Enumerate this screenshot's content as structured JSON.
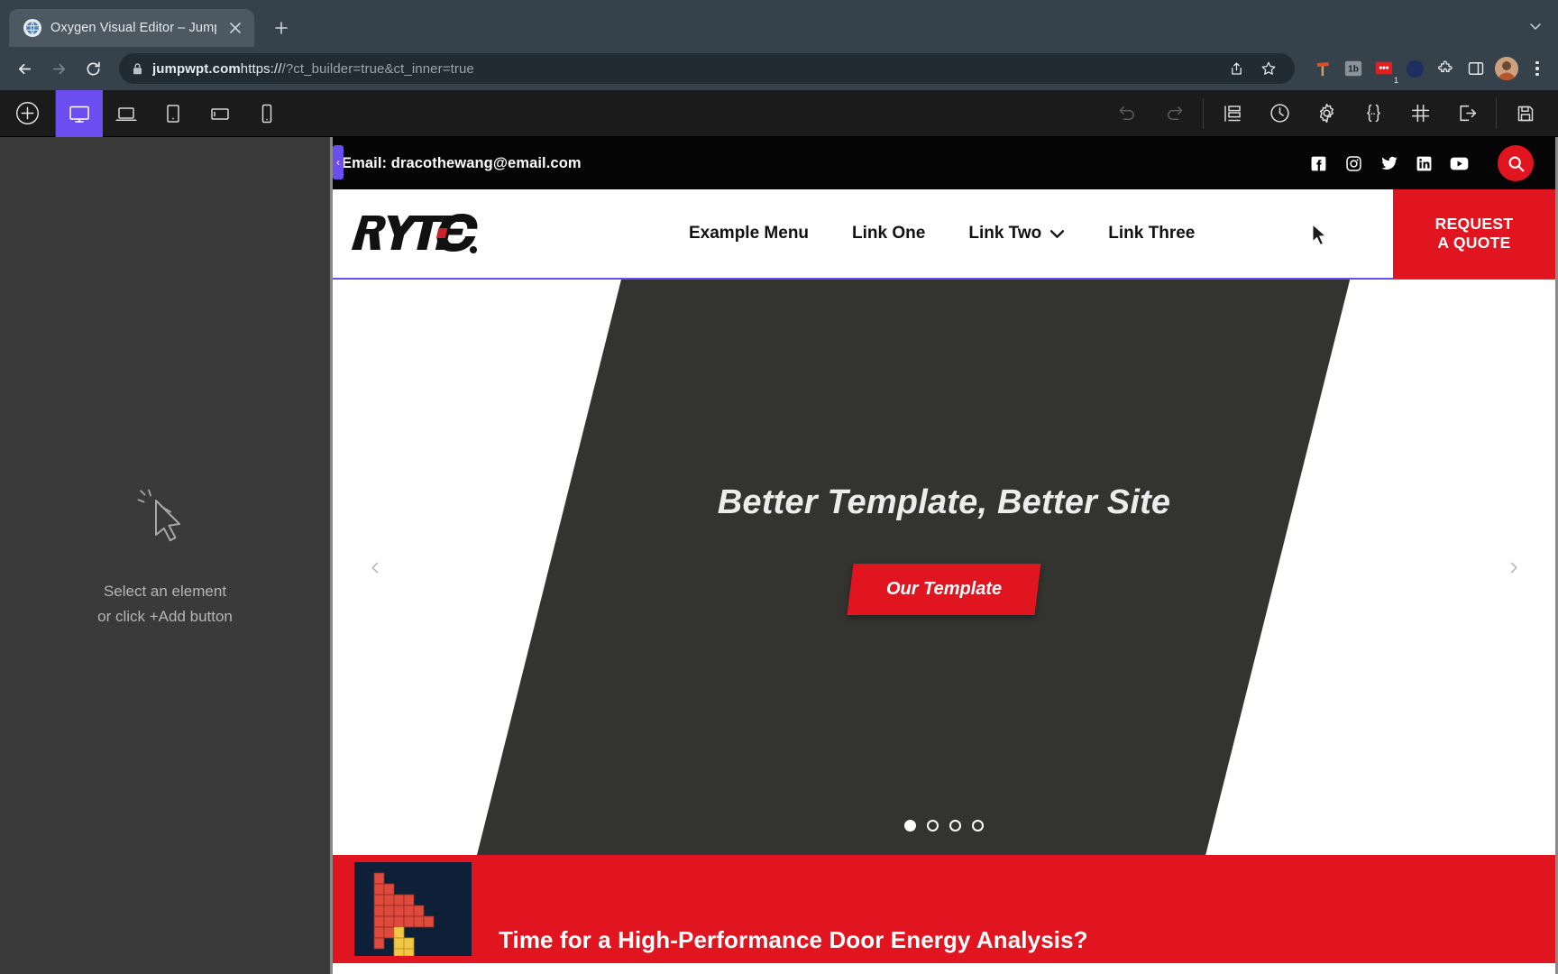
{
  "browser": {
    "tab": {
      "title": "Oxygen Visual Editor – JumpW",
      "favicon_icon": "globe-icon",
      "close_icon": "close-icon"
    },
    "new_tab_label": "+",
    "tabstrip_menu_icon": "chevron-down-icon",
    "nav": {
      "back_icon": "back-arrow-icon",
      "forward_icon": "forward-arrow-icon",
      "reload_icon": "reload-icon"
    },
    "url": {
      "lock_icon": "lock-icon",
      "scheme": "https://",
      "domain": "jumpwpt.com",
      "path": "/?ct_builder=true&ct_inner=true",
      "full": "https://jumpwpt.com/?ct_builder=true&ct_inner=true"
    },
    "omnibar_actions": [
      {
        "name": "share-icon",
        "label": "Share"
      },
      {
        "name": "bookmark-star-icon",
        "label": "Bookmark"
      }
    ],
    "extensions": [
      {
        "name": "hammer-extension-icon",
        "label": "Hammer",
        "color": "#d9502b",
        "badge": ""
      },
      {
        "name": "tb-extension-icon",
        "label": "tb",
        "color": "#8a9199",
        "badge": ""
      },
      {
        "name": "red-dots-extension-icon",
        "label": "•••",
        "color": "#e02020",
        "badge": "1"
      },
      {
        "name": "moon-extension-icon",
        "label": "Moon",
        "color": "#1d2f5e",
        "badge": ""
      },
      {
        "name": "puzzle-extensions-icon",
        "label": "Extensions",
        "color": "#e8eaed",
        "badge": ""
      },
      {
        "name": "side-panel-icon",
        "label": "Side panel",
        "color": "#e8eaed",
        "badge": ""
      }
    ],
    "profile_avatar": "avatar",
    "menu_icon": "three-dot-menu-icon"
  },
  "oxygen_toolbar": {
    "add_label": "+",
    "add_icon": "plus-circle-icon",
    "devices": [
      {
        "name": "device-desktop",
        "icon": "desktop-monitor-icon",
        "active": true
      },
      {
        "name": "device-laptop",
        "icon": "laptop-icon",
        "active": false
      },
      {
        "name": "device-tablet-portrait",
        "icon": "tablet-portrait-icon",
        "active": false
      },
      {
        "name": "device-tablet-landscape",
        "icon": "tablet-landscape-icon",
        "active": false
      },
      {
        "name": "device-phone",
        "icon": "phone-icon",
        "active": false
      }
    ],
    "actions": [
      {
        "name": "undo-button",
        "icon": "undo-icon",
        "enabled": false
      },
      {
        "name": "redo-button",
        "icon": "redo-icon",
        "enabled": false
      },
      {
        "name": "structure-button",
        "icon": "structure-panel-icon",
        "enabled": true
      },
      {
        "name": "history-button",
        "icon": "clock-history-icon",
        "enabled": true
      },
      {
        "name": "settings-button",
        "icon": "gear-icon",
        "enabled": true
      },
      {
        "name": "code-button",
        "icon": "curly-braces-icon",
        "enabled": true
      },
      {
        "name": "grid-button",
        "icon": "hash-grid-icon",
        "enabled": true
      },
      {
        "name": "exit-button",
        "icon": "exit-arrow-icon",
        "enabled": true
      },
      {
        "name": "save-button",
        "icon": "floppy-save-icon",
        "enabled": true
      }
    ]
  },
  "sidebar": {
    "cursor_icon": "click-cursor-icon",
    "line1": "Select an element",
    "line2": "or click +Add button"
  },
  "site": {
    "topbar": {
      "email_label": "Email: dracothewang@email.com",
      "socials": [
        {
          "name": "facebook-icon",
          "label": "Facebook"
        },
        {
          "name": "instagram-icon",
          "label": "Instagram"
        },
        {
          "name": "twitter-icon",
          "label": "Twitter"
        },
        {
          "name": "linkedin-icon",
          "label": "LinkedIn"
        },
        {
          "name": "youtube-icon",
          "label": "YouTube"
        }
      ],
      "search_icon": "search-icon",
      "search_bg": "#e0151f"
    },
    "header": {
      "logo_text": "RYTEC",
      "logo_accent_color": "#cc2229",
      "nav_items": [
        {
          "label": "Example Menu",
          "has_dropdown": false
        },
        {
          "label": "Link One",
          "has_dropdown": false
        },
        {
          "label": "Link Two",
          "has_dropdown": true
        },
        {
          "label": "Link Three",
          "has_dropdown": false
        }
      ],
      "dropdown_icon": "chevron-down-icon",
      "quote_line1": "REQUEST",
      "quote_line2": "A QUOTE",
      "quote_bg": "#e0151f"
    },
    "hero": {
      "title": "Better Template, Better Site",
      "cta_label": "Our Template",
      "cta_bg": "#e0151f",
      "slant_bg": "#333330",
      "prev_icon": "chevron-left-icon",
      "next_icon": "chevron-right-icon",
      "dots": 4,
      "active_dot": 1
    },
    "promo": {
      "bg": "#e0151f",
      "thumb_name": "energy-analysis-thumbnail",
      "title": "Time for a High-Performance Door Energy Analysis?"
    }
  },
  "colors": {
    "chrome_bg": "#35414b",
    "oxygen_bg": "#1b1b1b",
    "oxygen_sidebar": "#3a3a3a",
    "oxygen_accent": "#6c4ef0",
    "brand_red": "#e0151f",
    "canvas_frame": "#8a8a8a"
  }
}
